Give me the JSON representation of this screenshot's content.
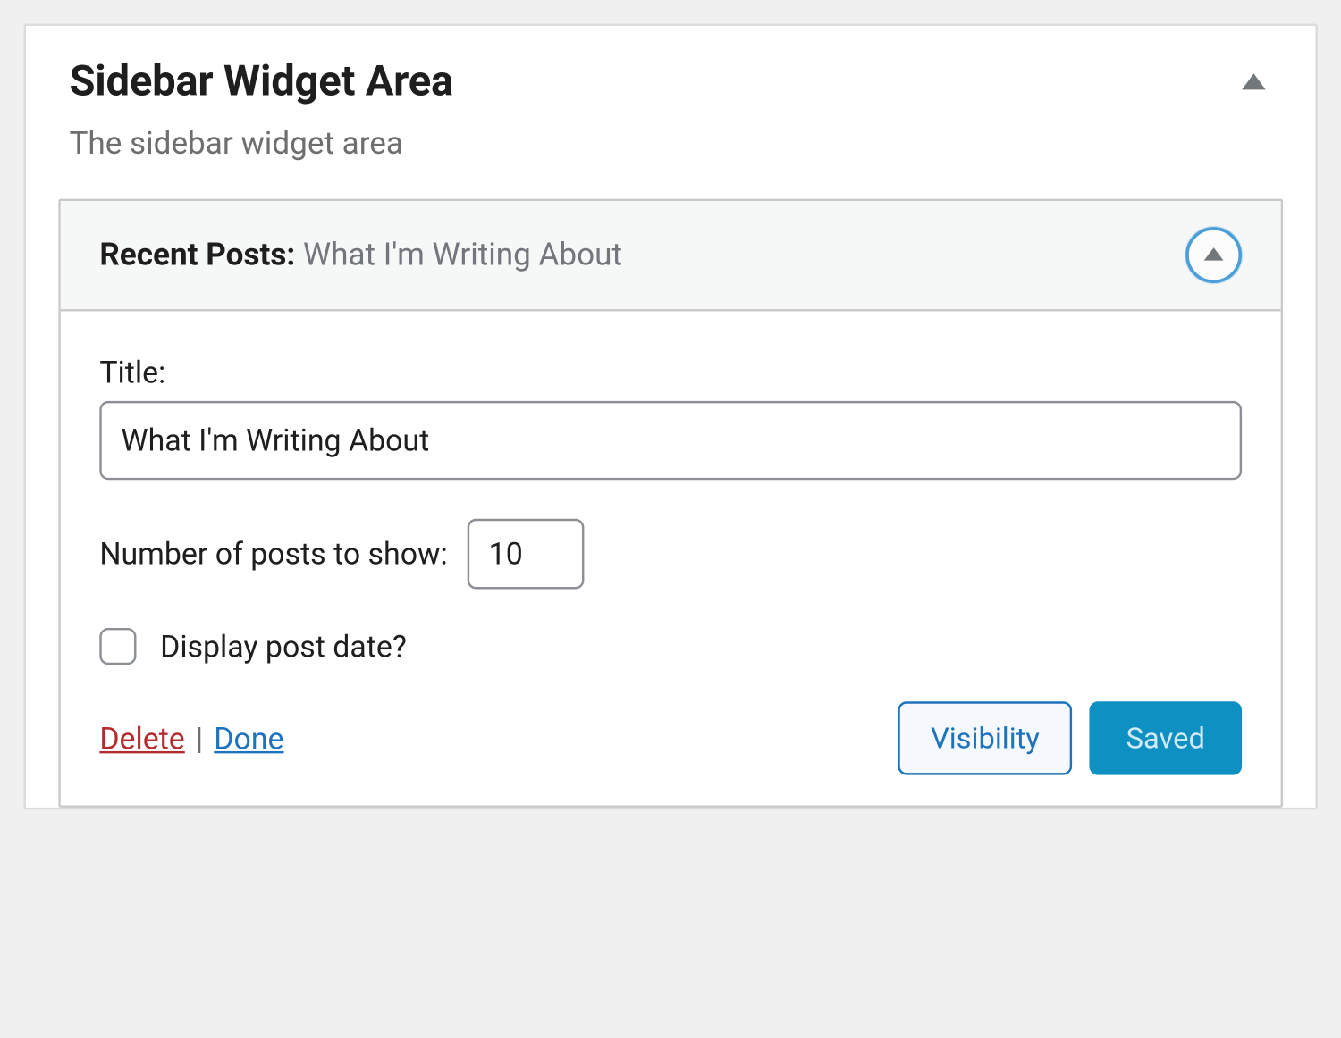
{
  "panel": {
    "title": "Sidebar Widget Area",
    "description": "The sidebar widget area"
  },
  "widget": {
    "type_label": "Recent Posts",
    "name": "What I'm Writing About",
    "fields": {
      "title_label": "Title:",
      "title_value": "What I'm Writing About",
      "count_label": "Number of posts to show:",
      "count_value": "10",
      "date_label": "Display post date?",
      "date_checked": false
    },
    "actions": {
      "delete": "Delete",
      "separator": "|",
      "done": "Done",
      "visibility": "Visibility",
      "saved": "Saved"
    }
  }
}
